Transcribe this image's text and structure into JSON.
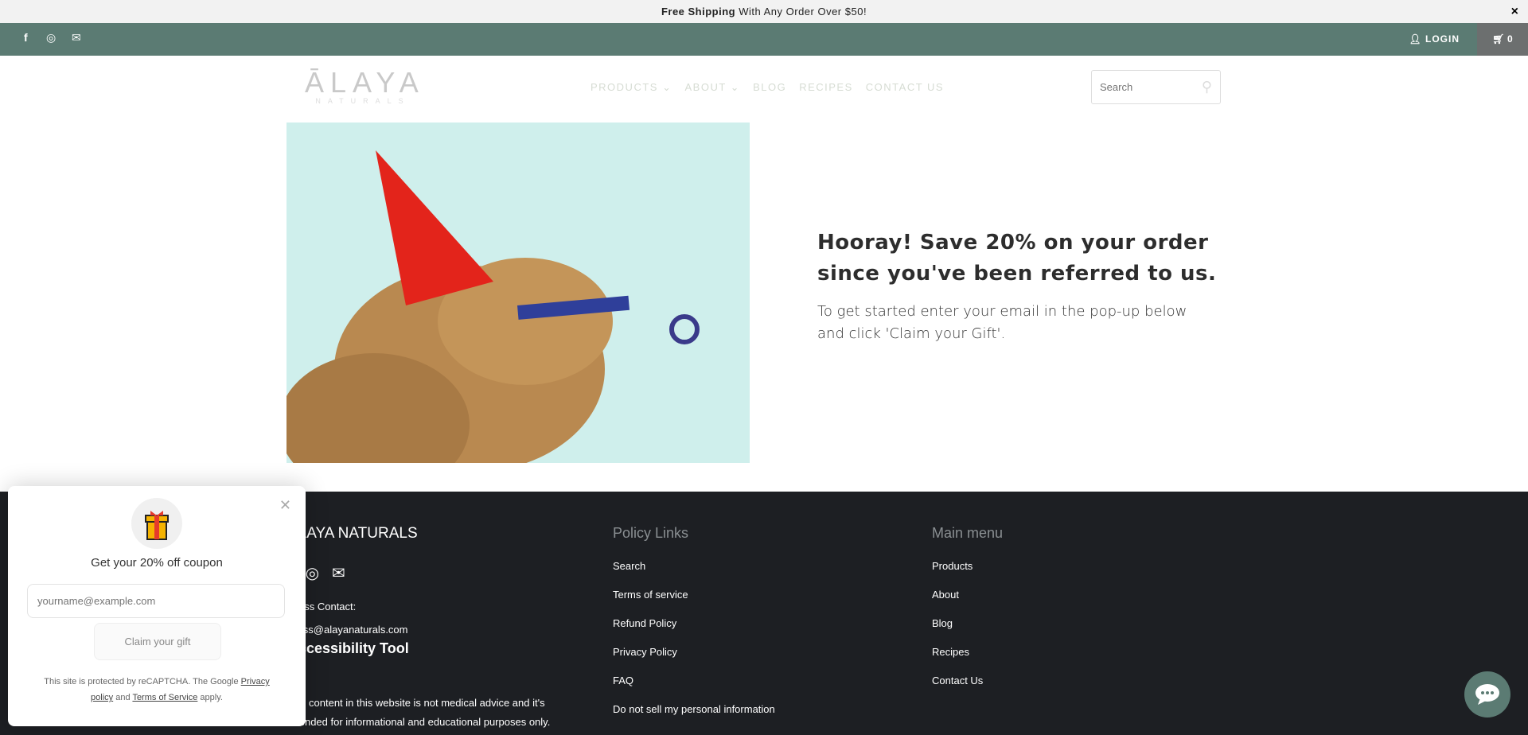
{
  "announcement": {
    "bold": "Free Shipping",
    "text": " With Any Order Over $50!",
    "close": "×"
  },
  "topbar": {
    "social": [
      "facebook-icon",
      "instagram-icon",
      "mail-icon"
    ],
    "login": "LOGIN",
    "cart_count": "0"
  },
  "header": {
    "logo_main": "ĀLAYA",
    "logo_sub": "NATURALS",
    "nav": [
      "PRODUCTS",
      "ABOUT",
      "BLOG",
      "RECIPES",
      "CONTACT US"
    ],
    "search_placeholder": "Search"
  },
  "hero": {
    "title": "Hooray! Save 20% on your order since you've been referred to us.",
    "text": "To get started enter your email in the pop-up below and click 'Claim your Gift'."
  },
  "footer": {
    "brand": "ALAYA NATURALS",
    "contact_label": "Press Contact:",
    "contact_email": "press@alayanaturals.com",
    "accessibility": "Accessibility Tool",
    "disclaimer": "The content in this website is not medical advice and it's intended for informational and educational purposes only.",
    "policy_heading": "Policy Links",
    "policy_links": [
      "Search",
      "Terms of service",
      "Refund Policy",
      "Privacy Policy",
      "FAQ",
      "Do not sell my personal information"
    ],
    "menu_heading": "Main menu",
    "menu_links": [
      "Products",
      "About",
      "Blog",
      "Recipes",
      "Contact Us"
    ]
  },
  "popup": {
    "title": "Get your 20% off coupon",
    "email_placeholder": "yourname@example.com",
    "button": "Claim your gift",
    "legal_1": "This site is protected by reCAPTCHA. The Google ",
    "privacy": "Privacy policy",
    "legal_2": " and ",
    "terms": "Terms of Service",
    "legal_3": " apply."
  },
  "colors": {
    "topbar": "#5b7b73",
    "footer": "#1d1f23"
  }
}
